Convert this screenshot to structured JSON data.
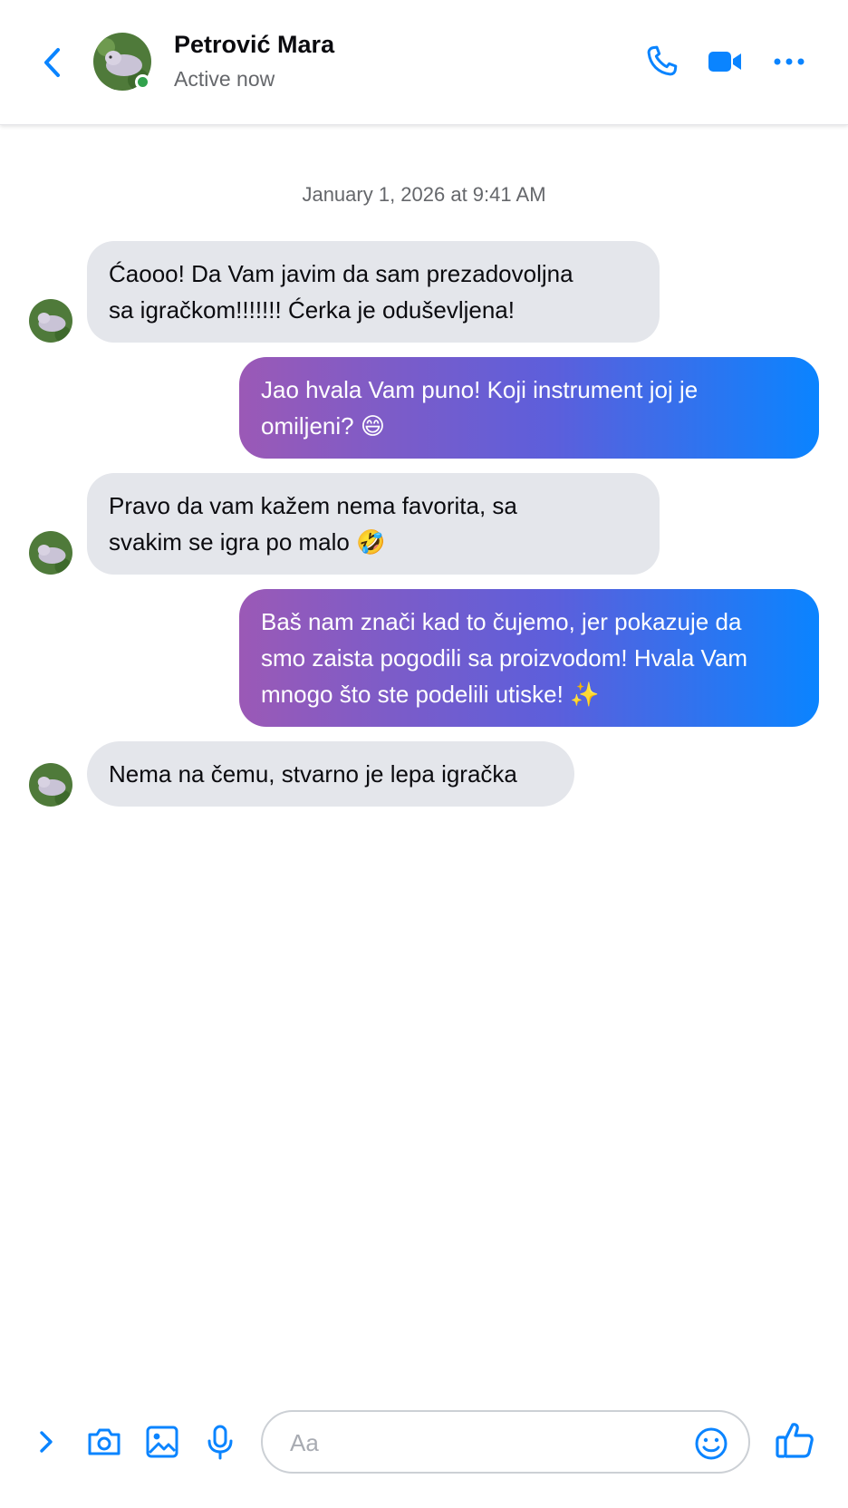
{
  "header": {
    "name": "Petrović Mara",
    "status": "Active now",
    "back_icon": "chevron-left-icon",
    "call_icon": "phone-icon",
    "video_icon": "video-camera-icon",
    "more_icon": "more-horizontal-icon"
  },
  "timestamp": "January 1, 2026 at 9:41 AM",
  "messages": [
    {
      "from": "them",
      "text": "Ćaooo! Da Vam javim da sam prezadovoljna\nsa igračkom!!!!!!! Ćerka je oduševljena!"
    },
    {
      "from": "me",
      "text": "Jao hvala Vam puno! Koji instrument joj je\nomiljeni? 😄"
    },
    {
      "from": "them",
      "text": "Pravo da vam kažem nema favorita, sa\nsvakim se igra po malo 🤣"
    },
    {
      "from": "me",
      "text": "Baš nam znači kad to čujemo, jer pokazuje da\nsmo zaista pogodili sa proizvodom! Hvala Vam\nmnogo što ste podelili utiske! ✨"
    },
    {
      "from": "them",
      "text": "Nema na čemu, stvarno je lepa igračka"
    }
  ],
  "composer": {
    "placeholder": "Aa",
    "icons": [
      "chevron-right-icon",
      "camera-icon",
      "image-icon",
      "microphone-icon",
      "emoji-icon",
      "thumbs-up-icon"
    ]
  },
  "colors": {
    "accent": "#0a84ff",
    "incoming_bubble": "#e4e6eb",
    "outgoing_gradient_start": "#9b59b6",
    "outgoing_gradient_end": "#0a84ff",
    "online": "#31a24c"
  }
}
